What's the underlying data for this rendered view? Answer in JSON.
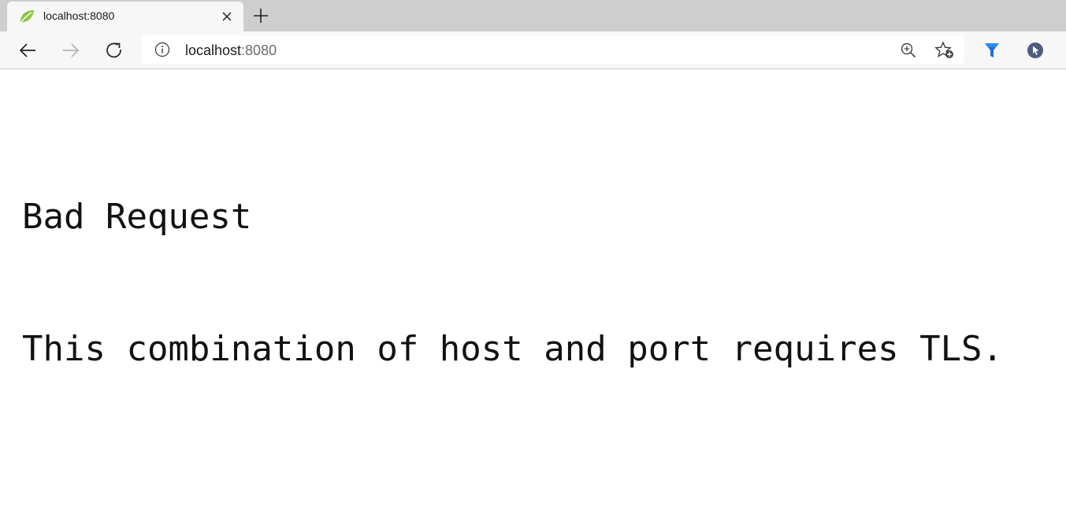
{
  "browser": {
    "tab": {
      "title": "localhost:8080",
      "favicon": "spring-leaf-icon"
    },
    "new_tab_icon": "plus-icon",
    "toolbar": {
      "back_icon": "back-arrow-icon",
      "forward_icon": "forward-arrow-icon",
      "reload_icon": "reload-icon",
      "address": {
        "host": "localhost",
        "port": ":8080",
        "site_info_icon": "info-icon"
      },
      "zoom_icon": "zoom-in-icon",
      "favorites_icon": "add-favorite-icon",
      "extensions": [
        "filter-funnel-icon",
        "cursor-circle-icon"
      ]
    }
  },
  "page": {
    "heading": "Bad Request",
    "message": "This combination of host and port requires TLS."
  },
  "colors": {
    "tabstrip": "#cecece",
    "toolbar": "#f7f7f7",
    "leaf": "#8dc63f",
    "ext_blue": "#1e6fd9",
    "ext_slate": "#4d5d7d"
  }
}
